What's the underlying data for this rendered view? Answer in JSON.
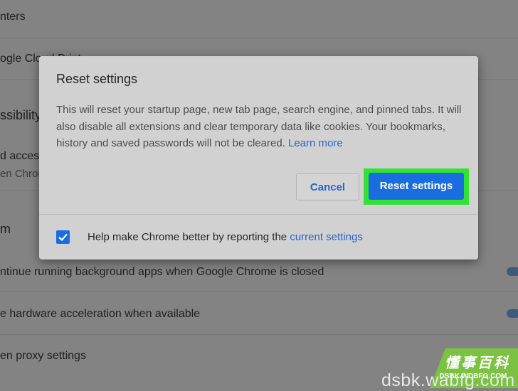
{
  "background": {
    "rows": [
      {
        "text": "nters"
      },
      {
        "text": "ogle Cloud Print"
      },
      {
        "text": "ssibility"
      },
      {
        "text": "d access",
        "sub": "en Chrom"
      },
      {
        "text": "m"
      },
      {
        "text": "ntinue running background apps when Google Chrome is closed"
      },
      {
        "text": "e hardware acceleration when available"
      },
      {
        "text": "en proxy settings"
      }
    ]
  },
  "dialog": {
    "title": "Reset settings",
    "body": "This will reset your startup page, new tab page, search engine, and pinned tabs. It will also disable all extensions and clear temporary data like cookies. Your bookmarks, history and saved passwords will not be cleared.",
    "learn_more": "Learn more",
    "cancel_label": "Cancel",
    "reset_label": "Reset settings",
    "checkbox_checked": true,
    "footer_text": "Help make Chrome better by reporting the",
    "footer_link": "current settings"
  },
  "watermark": {
    "title": "懂事百科",
    "subtitle": "DSBK.WDBFG.COM",
    "url": "dsbk.wabfg.com",
    "flag_color": "#7bc142"
  },
  "colors": {
    "accent": "#1a6ddf",
    "highlight": "#32e234",
    "link": "#2a64c8"
  }
}
